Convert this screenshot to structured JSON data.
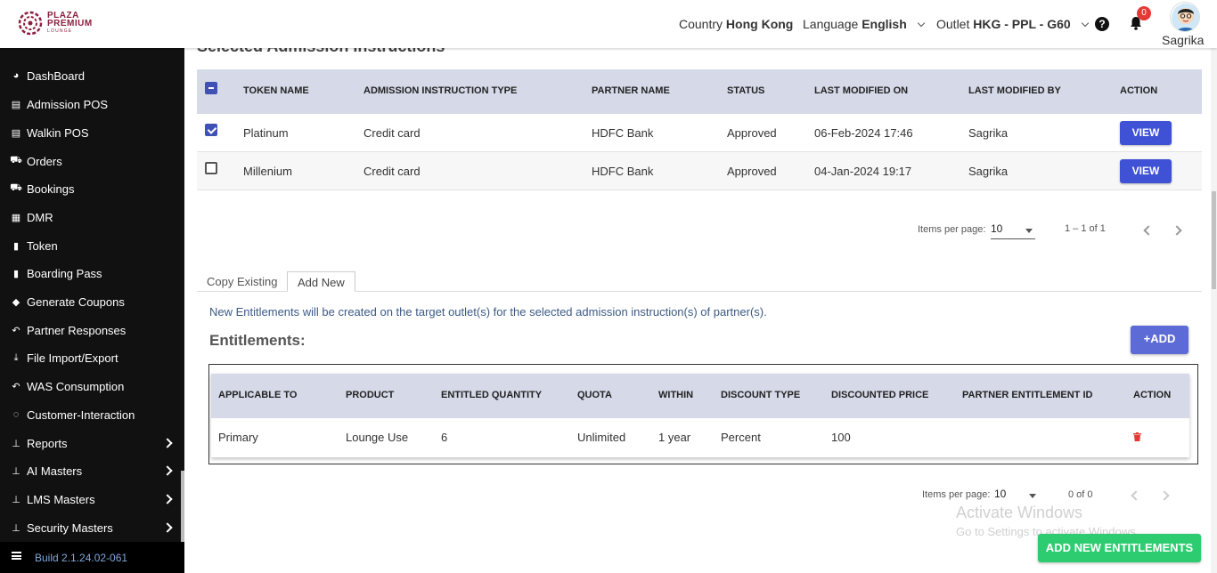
{
  "header": {
    "logo_line1": "PLAZA",
    "logo_line2": "PREMIUM",
    "logo_line3": "LOUNGE",
    "country_label": "Country",
    "country_value": "Hong Kong",
    "language_label": "Language",
    "language_value": "English",
    "outlet_label": "Outlet",
    "outlet_value": "HKG - PPL - G60",
    "help_glyph": "?",
    "notification_count": "0",
    "user_name": "Sagrika"
  },
  "sidebar": {
    "items": [
      {
        "label": "DashBoard",
        "icon": "dashboard-icon",
        "has_arrow": false
      },
      {
        "label": "Admission POS",
        "icon": "id-card-icon",
        "has_arrow": false
      },
      {
        "label": "Walkin POS",
        "icon": "id-card-icon",
        "has_arrow": false
      },
      {
        "label": "Orders",
        "icon": "cart-icon",
        "has_arrow": false
      },
      {
        "label": "Bookings",
        "icon": "cart-icon",
        "has_arrow": false
      },
      {
        "label": "DMR",
        "icon": "calendar-icon",
        "has_arrow": false
      },
      {
        "label": "Token",
        "icon": "file-icon",
        "has_arrow": false
      },
      {
        "label": "Boarding Pass",
        "icon": "file-icon",
        "has_arrow": false
      },
      {
        "label": "Generate Coupons",
        "icon": "tag-icon",
        "has_arrow": false
      },
      {
        "label": "Partner Responses",
        "icon": "reply-icon",
        "has_arrow": false
      },
      {
        "label": "File Import/Export",
        "icon": "download-icon",
        "has_arrow": false
      },
      {
        "label": "WAS Consumption",
        "icon": "reply-icon",
        "has_arrow": false
      },
      {
        "label": "Customer-Interaction",
        "icon": "chat-icon",
        "has_arrow": false
      },
      {
        "label": "Reports",
        "icon": "sitemap-icon",
        "has_arrow": true
      },
      {
        "label": "AI Masters",
        "icon": "sitemap-icon",
        "has_arrow": true
      },
      {
        "label": "LMS Masters",
        "icon": "sitemap-icon",
        "has_arrow": true
      },
      {
        "label": "Security Masters",
        "icon": "sitemap-icon",
        "has_arrow": true
      }
    ],
    "build": "Build 2.1.24.02-061"
  },
  "admission": {
    "title": "Selected Admission Instructions",
    "columns": [
      "TOKEN NAME",
      "ADMISSION INSTRUCTION TYPE",
      "PARTNER NAME",
      "STATUS",
      "LAST MODIFIED ON",
      "LAST MODIFIED BY",
      "ACTION"
    ],
    "rows": [
      {
        "checked": true,
        "token": "Platinum",
        "type": "Credit card",
        "partner": "HDFC Bank",
        "status": "Approved",
        "modified_on": "06-Feb-2024 17:46",
        "modified_by": "Sagrika",
        "action": "VIEW"
      },
      {
        "checked": false,
        "token": "Millenium",
        "type": "Credit card",
        "partner": "HDFC Bank",
        "status": "Approved",
        "modified_on": "04-Jan-2024 19:17",
        "modified_by": "Sagrika",
        "action": "VIEW"
      }
    ],
    "paginator": {
      "label": "Items per page:",
      "page_size": "10",
      "range": "1 – 1 of 1"
    }
  },
  "tabs": [
    {
      "label": "Copy Existing",
      "active": false
    },
    {
      "label": "Add New",
      "active": true
    }
  ],
  "entitlements": {
    "info_text": "New Entitlements will be created on the target outlet(s) for the selected admission instruction(s) of partner(s).",
    "title": "Entitlements:",
    "add_button": "ADD",
    "columns": [
      "APPLICABLE TO",
      "PRODUCT",
      "ENTITLED QUANTITY",
      "QUOTA",
      "WITHIN",
      "DISCOUNT TYPE",
      "DISCOUNTED PRICE",
      "PARTNER ENTITLEMENT ID",
      "ACTION"
    ],
    "rows": [
      {
        "applicable_to": "Primary",
        "product": "Lounge Use",
        "quantity": "6",
        "quota": "Unlimited",
        "within": "1 year",
        "discount_type": "Percent",
        "discounted_price": "100",
        "partner_entitlement_id": ""
      }
    ],
    "paginator": {
      "label": "Items per page:",
      "page_size": "10",
      "range": "0 of 0"
    },
    "submit_button": "ADD NEW ENTITLEMENTS"
  },
  "watermark": {
    "line1": "Activate Windows",
    "line2": "Go to Settings to activate Windows."
  },
  "colors": {
    "brand": "#8b1e3f",
    "sidebar_bg": "#111111",
    "table_header_bg": "#d5d9e8",
    "primary_button": "#3f51d5",
    "success_button": "#2ecc71",
    "badge": "#e53935"
  }
}
